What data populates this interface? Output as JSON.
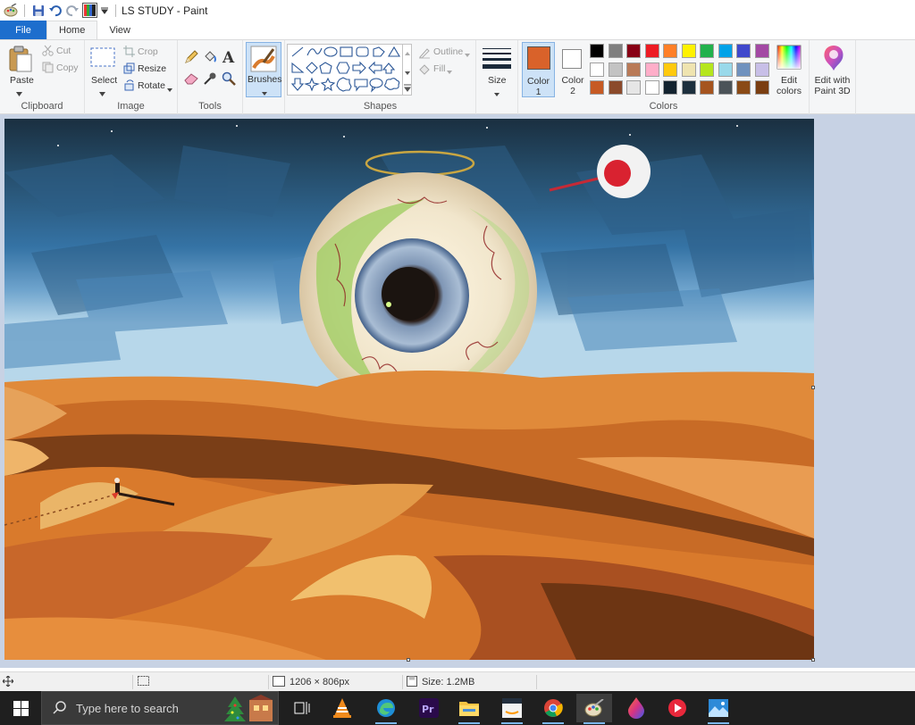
{
  "window": {
    "title": "LS STUDY - Paint"
  },
  "tabs": [
    {
      "label": "File"
    },
    {
      "label": "Home"
    },
    {
      "label": "View"
    }
  ],
  "ribbon": {
    "clipboard": {
      "group": "Clipboard",
      "paste": "Paste",
      "cut": "Cut",
      "copy": "Copy"
    },
    "image": {
      "group": "Image",
      "select": "Select",
      "crop": "Crop",
      "resize": "Resize",
      "rotate": "Rotate"
    },
    "tools": {
      "group": "Tools"
    },
    "brushes": {
      "label": "Brushes"
    },
    "shapes": {
      "group": "Shapes",
      "outline": "Outline",
      "fill": "Fill"
    },
    "size": {
      "label": "Size"
    },
    "colors": {
      "group": "Colors",
      "color1": "Color 1",
      "color1_l1": "Color",
      "color1_l2": "1",
      "color2": "Color 2",
      "color2_l1": "Color",
      "color2_l2": "2",
      "color1_value": "#d9622a",
      "color2_value": "#ffffff",
      "edit_l1": "Edit",
      "edit_l2": "colors",
      "paint3d_l1": "Edit with",
      "paint3d_l2": "Paint 3D",
      "palette_row1": [
        "#000000",
        "#7f7f7f",
        "#880015",
        "#ed1c24",
        "#ff7f27",
        "#fff200",
        "#22b14c",
        "#00a2e8",
        "#3f48cc",
        "#a349a4"
      ],
      "palette_row2": [
        "#ffffff",
        "#c3c3c3",
        "#b97a57",
        "#ffaec9",
        "#ffc90e",
        "#efe4b0",
        "#b5e61d",
        "#99d9ea",
        "#7092be",
        "#c8bfe7"
      ],
      "palette_row3": [
        "#c65a24",
        "#8b4a2b",
        "#e6e6e6",
        "#ffffff",
        "#13232f",
        "#1c2f3d",
        "#a5541f",
        "#4b5358",
        "#8a4a16",
        "#7a3e12"
      ]
    }
  },
  "status": {
    "dimensions": "1206 × 806px",
    "size": "Size: 1.2MB"
  },
  "taskbar": {
    "search_placeholder": "Type here to search"
  }
}
